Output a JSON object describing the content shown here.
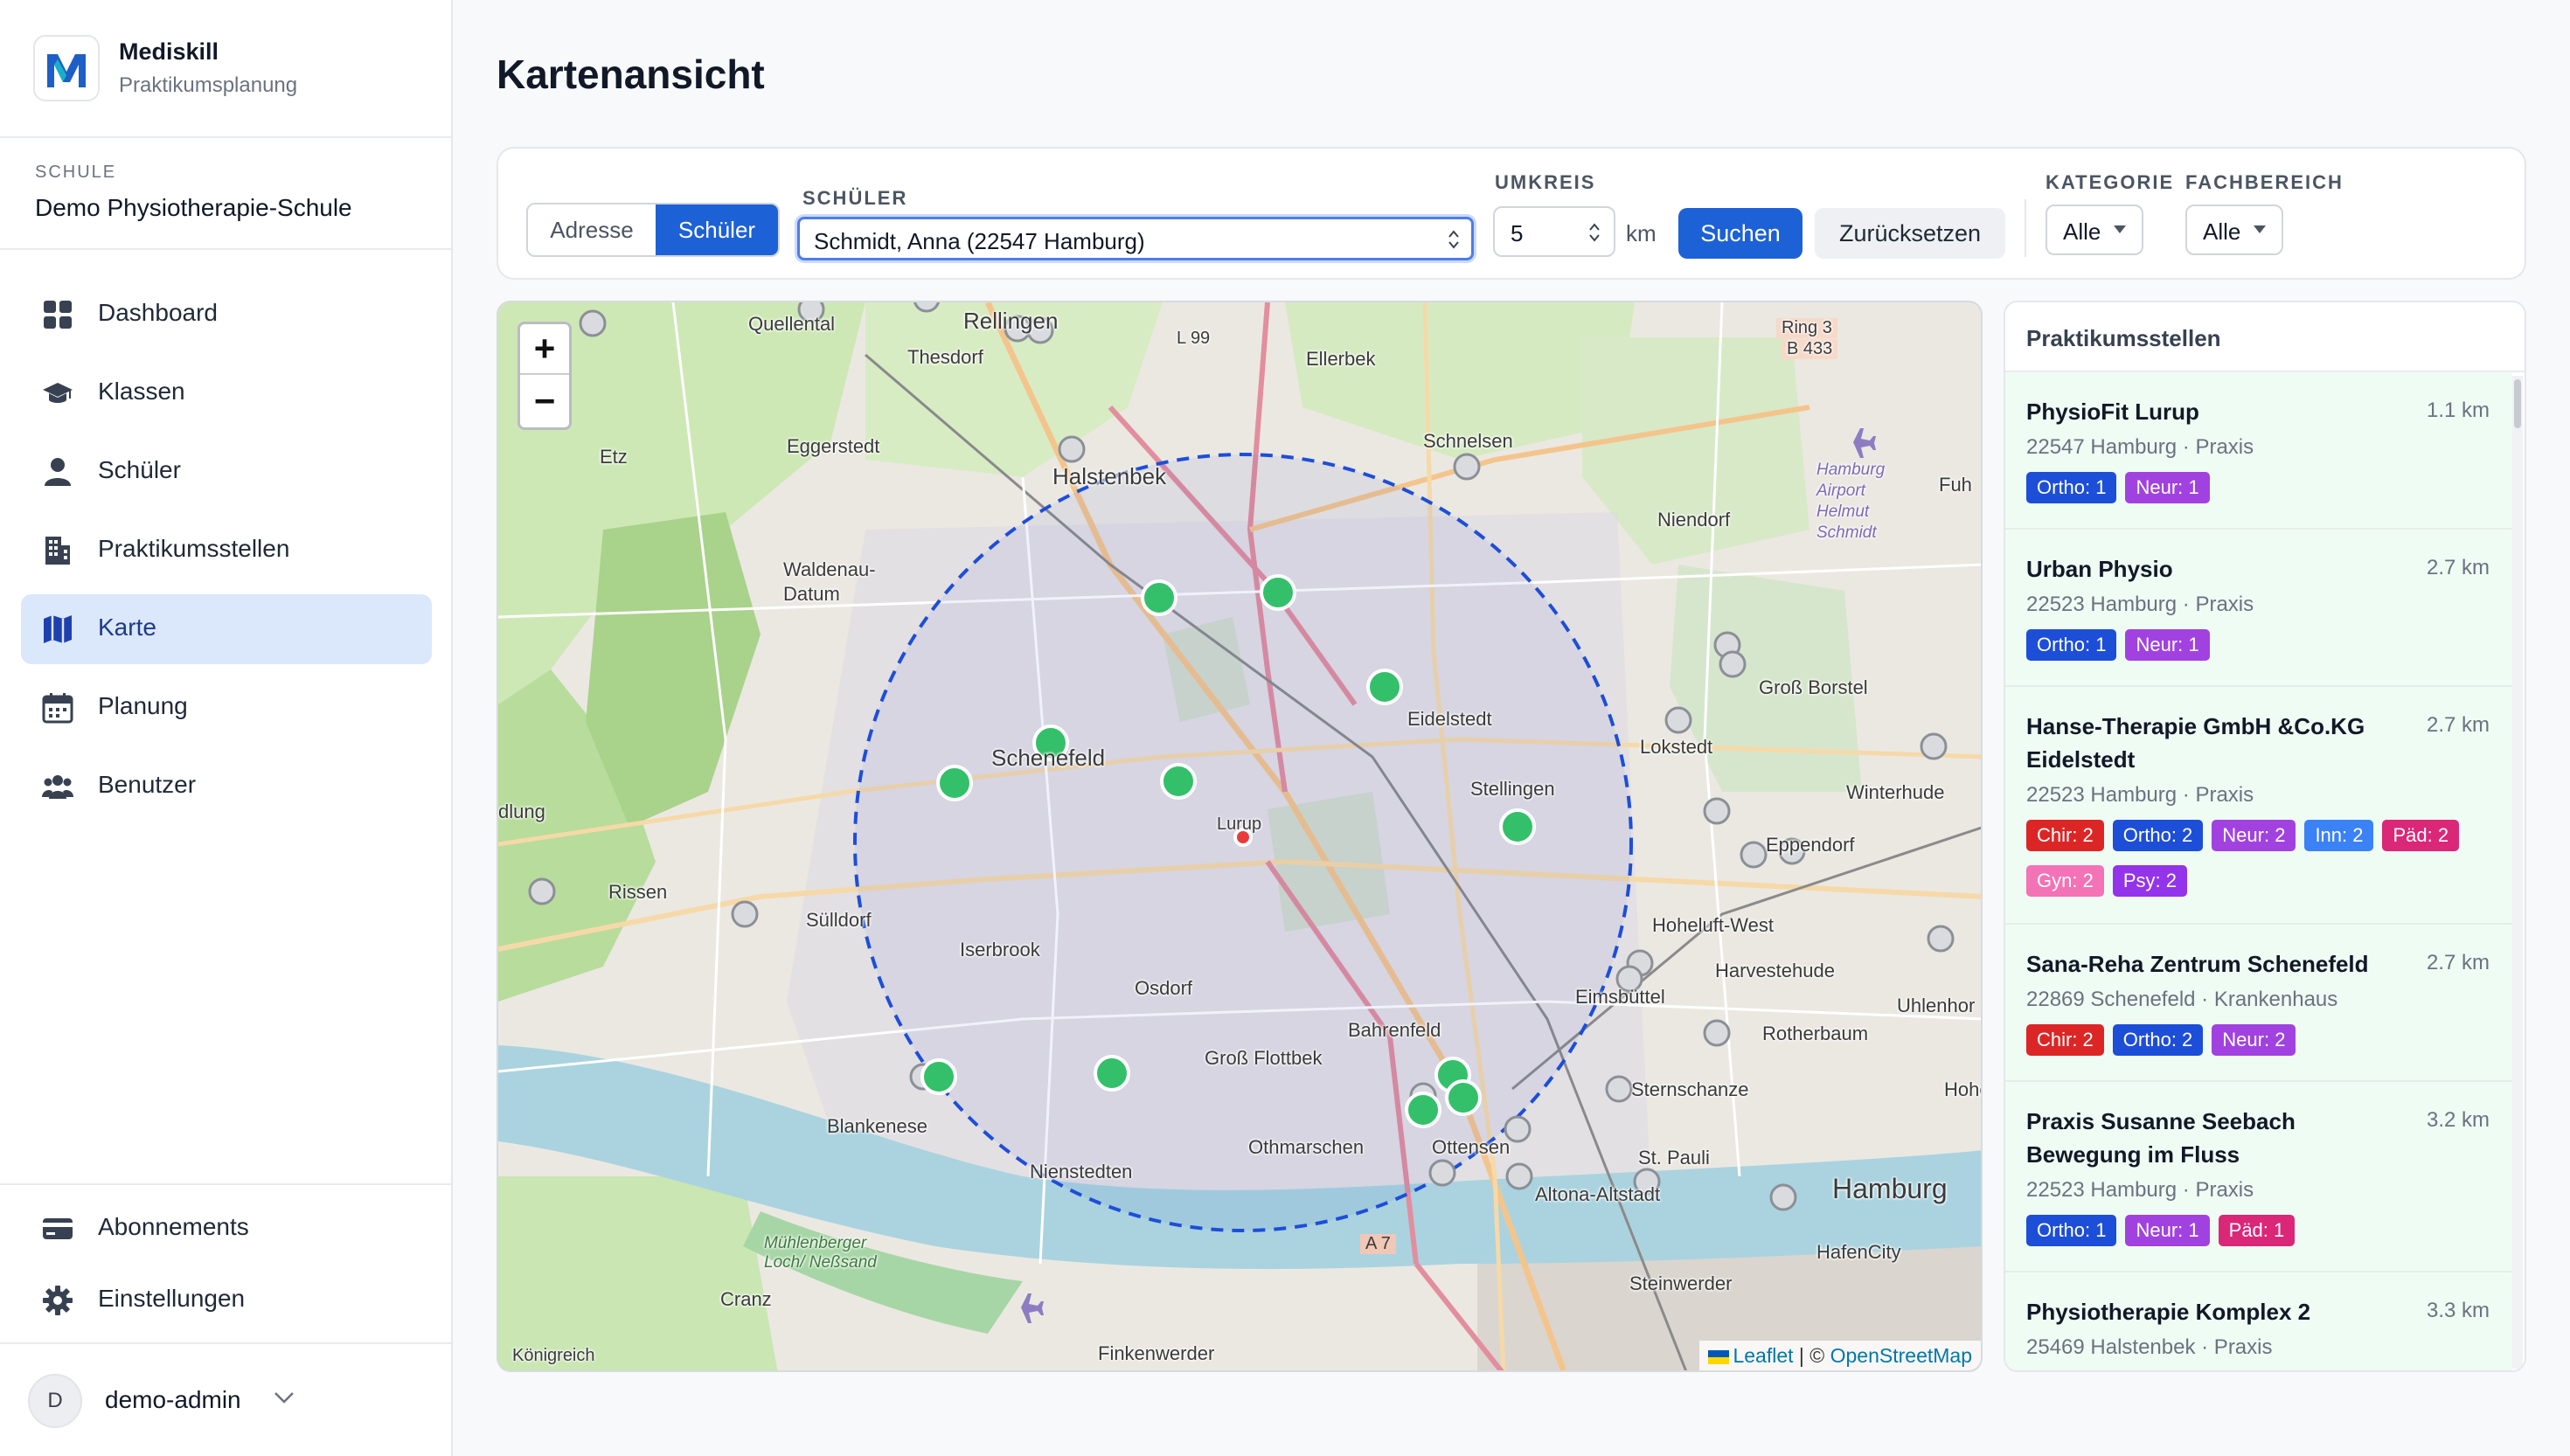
{
  "brand": {
    "name": "Mediskill",
    "subtitle": "Praktikumsplanung"
  },
  "school": {
    "label": "SCHULE",
    "name": "Demo Physiotherapie-Schule"
  },
  "nav": {
    "items": [
      {
        "label": "Dashboard",
        "icon": "dashboard-icon"
      },
      {
        "label": "Klassen",
        "icon": "graduation-cap-icon"
      },
      {
        "label": "Schüler",
        "icon": "user-icon"
      },
      {
        "label": "Praktikumsstellen",
        "icon": "building-icon"
      },
      {
        "label": "Karte",
        "icon": "map-icon",
        "active": true
      },
      {
        "label": "Planung",
        "icon": "calendar-icon"
      },
      {
        "label": "Benutzer",
        "icon": "users-icon"
      }
    ],
    "bottom": [
      {
        "label": "Abonnements",
        "icon": "credit-card-icon"
      },
      {
        "label": "Einstellungen",
        "icon": "gear-icon"
      }
    ]
  },
  "user": {
    "initial": "D",
    "name": "demo-admin"
  },
  "page": {
    "title": "Kartenansicht"
  },
  "filters": {
    "mode_options": [
      "Adresse",
      "Schüler"
    ],
    "mode_selected": "Schüler",
    "student_label": "SCHÜLER",
    "student_value": "Schmidt, Anna (22547 Hamburg)",
    "radius_label": "UMKREIS",
    "radius_value": "5",
    "radius_unit": "km",
    "search_label": "Suchen",
    "reset_label": "Zurücksetzen",
    "category_label": "KATEGORIE",
    "category_value": "Alle",
    "field_label": "FACHBEREICH",
    "field_value": "Alle"
  },
  "map": {
    "zoom_in": "+",
    "zoom_out": "−",
    "attribution_leaflet": "Leaflet",
    "attribution_sep": " | © ",
    "attribution_osm": "OpenStreetMap",
    "labels": [
      "Quellental",
      "Rellingen",
      "Thesdorf",
      "L 99",
      "Ellerbek",
      "Ring 3",
      "B 433",
      "Eggerstedt",
      "Halstenbek",
      "Schnelsen",
      "Etz",
      "Niendorf",
      "Hamburg Airport Helmut Schmidt",
      "Fuh",
      "Waldenau-Datum",
      "Groß Borstel",
      "Eidelstedt",
      "Schenefeld",
      "Lokstedt",
      "Stellingen",
      "Lurup",
      "Winterhude",
      "dlung",
      "Eppendorf",
      "Rissen",
      "Sülldorf",
      "Hoheluft-West",
      "Iserbrook",
      "Harvestehude",
      "Osdorf",
      "Eimsbüttel",
      "Uhlenhor",
      "Bahrenfeld",
      "Rotherbaum",
      "Groß Flottbek",
      "Sternschanze",
      "Blankenese",
      "Hohe",
      "Othmarschen",
      "Ottensen",
      "St. Pauli",
      "Nienstedten",
      "Altona-Altstadt",
      "Hamburg",
      "HafenCity",
      "A 7",
      "Mühlenberger Loch/ Neßsand",
      "Steinwerder",
      "Cranz",
      "Königreich",
      "Finkenwerder"
    ]
  },
  "results": {
    "title": "Praktikumsstellen",
    "items": [
      {
        "name": "PhysioFit Lurup",
        "distance": "1.1 km",
        "sub": "22547 Hamburg · Praxis",
        "badges": [
          {
            "text": "Ortho: 1",
            "color": "#1d4ed8"
          },
          {
            "text": "Neur: 1",
            "color": "#a142e0"
          }
        ]
      },
      {
        "name": "Urban Physio",
        "distance": "2.7 km",
        "sub": "22523 Hamburg · Praxis",
        "badges": [
          {
            "text": "Ortho: 1",
            "color": "#1d4ed8"
          },
          {
            "text": "Neur: 1",
            "color": "#a142e0"
          }
        ]
      },
      {
        "name": "Hanse-Therapie GmbH &Co.KG Eidelstedt",
        "distance": "2.7 km",
        "sub": "22523 Hamburg · Praxis",
        "badges": [
          {
            "text": "Chir: 2",
            "color": "#dc2626"
          },
          {
            "text": "Ortho: 2",
            "color": "#1d4ed8"
          },
          {
            "text": "Neur: 2",
            "color": "#a142e0"
          },
          {
            "text": "Inn: 2",
            "color": "#3b82f6"
          },
          {
            "text": "Päd: 2",
            "color": "#db2777"
          },
          {
            "text": "Gyn: 2",
            "color": "#f472b6"
          },
          {
            "text": "Psy: 2",
            "color": "#9333ea"
          }
        ]
      },
      {
        "name": "Sana-Reha Zentrum Schenefeld",
        "distance": "2.7 km",
        "sub": "22869 Schenefeld · Krankenhaus",
        "badges": [
          {
            "text": "Chir: 2",
            "color": "#dc2626"
          },
          {
            "text": "Ortho: 2",
            "color": "#1d4ed8"
          },
          {
            "text": "Neur: 2",
            "color": "#a142e0"
          }
        ]
      },
      {
        "name": "Praxis Susanne Seebach Bewegung im Fluss",
        "distance": "3.2 km",
        "sub": "22523 Hamburg · Praxis",
        "badges": [
          {
            "text": "Ortho: 1",
            "color": "#1d4ed8"
          },
          {
            "text": "Neur: 1",
            "color": "#a142e0"
          },
          {
            "text": "Päd: 1",
            "color": "#db2777"
          }
        ]
      },
      {
        "name": "Physiotherapie Komplex 2",
        "distance": "3.3 km",
        "sub": "25469 Halstenbek · Praxis",
        "badges": []
      }
    ]
  },
  "colors": {
    "accent": "#1d61d6",
    "active_nav_bg": "#dbe8fb",
    "marker_green": "#34c06a",
    "radius_circle": "#1d4ed8",
    "card_bg": "#effcf4"
  }
}
